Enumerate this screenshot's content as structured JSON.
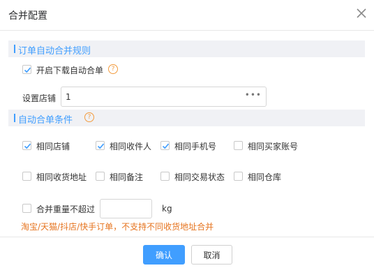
{
  "dialog": {
    "title": "合并配置",
    "close_icon": "close-icon"
  },
  "section1": {
    "title": "订单自动合并规则",
    "auto_merge_download": {
      "label": "开启下载自动合单",
      "checked": true
    },
    "store": {
      "label": "设置店铺",
      "value": "1",
      "more_icon": "ellipsis-icon"
    }
  },
  "section2": {
    "title": "自动合单条件",
    "conditions": [
      {
        "label": "相同店铺",
        "checked": true
      },
      {
        "label": "相同收件人",
        "checked": true
      },
      {
        "label": "相同手机号",
        "checked": true
      },
      {
        "label": "相同买家账号",
        "checked": false
      },
      {
        "label": "相同收货地址",
        "checked": false
      },
      {
        "label": "相同备注",
        "checked": false
      },
      {
        "label": "相同交易状态",
        "checked": false
      },
      {
        "label": "相同仓库",
        "checked": false
      }
    ],
    "weight": {
      "label": "合并重量不超过",
      "value": "",
      "unit": "kg",
      "checked": false
    },
    "warning": "淘宝/天猫/抖店/快手订单，不支持不同收货地址合并"
  },
  "footer": {
    "confirm_label": "确认",
    "cancel_label": "取消"
  },
  "colors": {
    "accent": "#409eff",
    "warning": "#e6741f",
    "help": "#f39b3d"
  }
}
